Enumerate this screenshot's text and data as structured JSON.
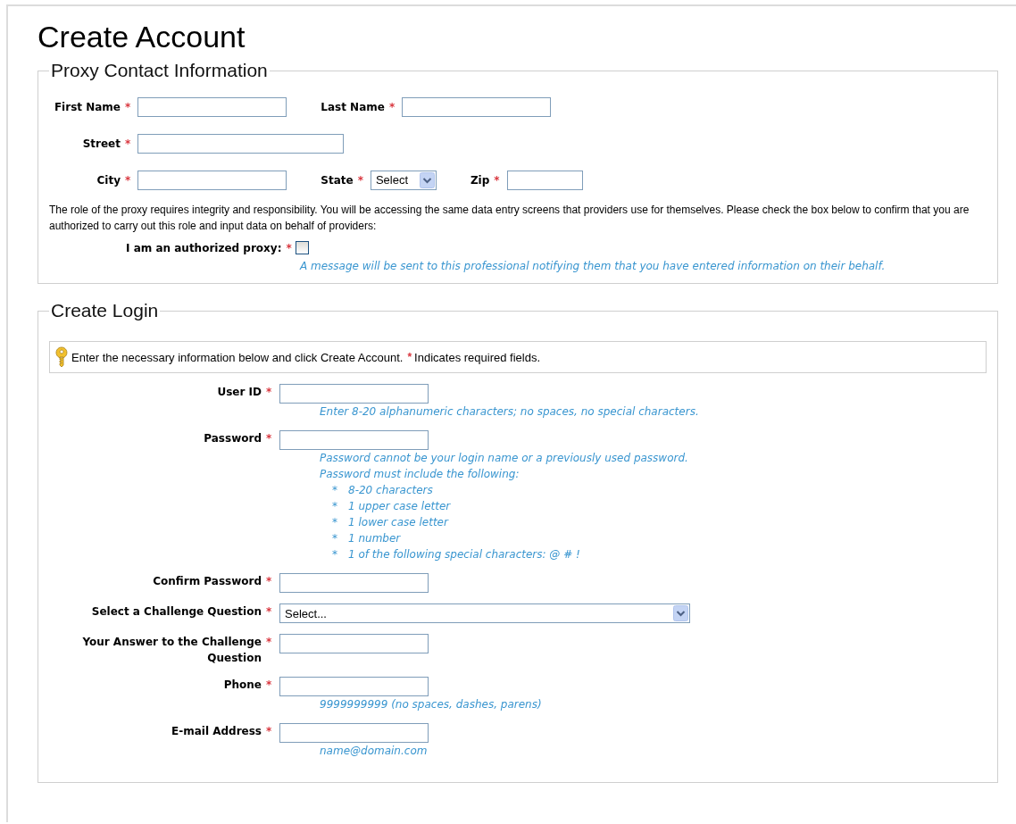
{
  "title": "Create Account",
  "proxy": {
    "legend": "Proxy Contact Information",
    "rows": [
      [
        {
          "label": "First Name",
          "mark": "*",
          "kind": "input"
        },
        {
          "label": "Last Name",
          "mark": "*",
          "kind": "input"
        }
      ],
      [
        {
          "label": "Street",
          "mark": "*",
          "kind": "wide-input"
        }
      ],
      [
        {
          "label": "City",
          "mark": "*",
          "kind": "input"
        },
        {
          "label": "State",
          "mark": "*",
          "kind": "select",
          "value": "Select"
        },
        {
          "label": "Zip",
          "mark": "*",
          "kind": "small-input"
        }
      ]
    ],
    "paragraph": "The role of the proxy requires integrity and responsibility.  You will be accessing the same data entry screens that providers use for themselves.  Please check the box below to confirm that you are authorized to carry out this role and input data on behalf of providers:",
    "authorized": {
      "label": "I am an authorized proxy:",
      "mark": "*",
      "checked": false,
      "note": "A message will be sent to this professional notifying them that you have entered information on their behalf."
    }
  },
  "login": {
    "legend": "Create Login",
    "info": {
      "text": "Enter the necessary information below and click Create Account.",
      "mark": "*",
      "text2": "Indicates required fields."
    },
    "fields": [
      {
        "label": "User ID",
        "mark": "*",
        "kind": "input",
        "hints": [
          "Enter 8-20 alphanumeric characters; no spaces, no special characters."
        ]
      },
      {
        "label": "Password",
        "mark": "*",
        "kind": "input",
        "hints": [
          "Password cannot be your login name or a previously used password.",
          "Password must include the following:"
        ],
        "bullets": [
          {
            "mark": "*",
            "text": "8-20 characters"
          },
          {
            "mark": "*",
            "text": "1 upper case letter"
          },
          {
            "mark": "*",
            "text": "1 lower case letter"
          },
          {
            "mark": "*",
            "text": "1 number"
          },
          {
            "mark": "*",
            "text": "1 of the following special characters: @ # !"
          }
        ]
      },
      {
        "label": "Confirm Password",
        "mark": "*",
        "kind": "input"
      },
      {
        "label": "Select a Challenge Question",
        "mark": "*",
        "kind": "select",
        "value": "Select..."
      },
      {
        "label": "Your Answer to the Challenge Question",
        "mark": "*",
        "kind": "input"
      },
      {
        "label": "Phone",
        "mark": "*",
        "kind": "input",
        "hints": [
          "9999999999 (no spaces, dashes, parens)"
        ]
      },
      {
        "label": "E-mail Address",
        "mark": "*",
        "kind": "input",
        "hints": [
          "name@domain.com"
        ]
      }
    ]
  }
}
